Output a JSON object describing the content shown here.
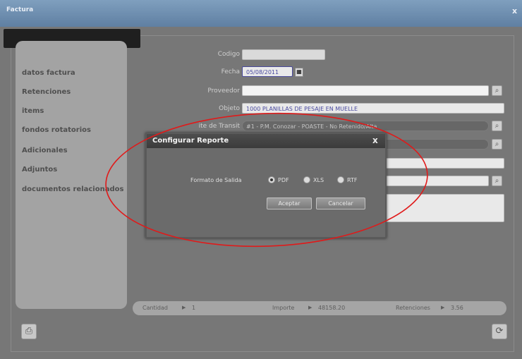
{
  "window": {
    "title": "Factura",
    "close_glyph": "x"
  },
  "sidebar": {
    "items": [
      {
        "label": "datos factura"
      },
      {
        "label": "Retenciones"
      },
      {
        "label": "items"
      },
      {
        "label": "fondos rotatorios"
      },
      {
        "label": "Adicionales"
      },
      {
        "label": "Adjuntos"
      },
      {
        "label": "documentos relacionados"
      }
    ]
  },
  "form": {
    "codigo_label": "Codigo",
    "fecha_label": "Fecha",
    "fecha_value": "05/08/2011",
    "proveedor_label": "Proveedor",
    "objeto_label": "Objeto",
    "objeto_value": "1000 PLANILLAS DE PESAJE EN MUELLE",
    "tipo_label": "ite de Transit",
    "tipo_value": "#1 - P.M. Conozar - POASTE - No Retenido/Alta"
  },
  "status": {
    "cantidad_label": "Cantidad",
    "cantidad_value": "1",
    "importe_label": "Importe",
    "importe_value": "48158.20",
    "retenciones_label": "Retenciones",
    "retenciones_value": "3.56"
  },
  "dialog": {
    "title": "Configurar Reporte",
    "close_glyph": "x",
    "format_label": "Formato de Salida",
    "options": [
      {
        "label": "PDF",
        "selected": true
      },
      {
        "label": "XLS",
        "selected": false
      },
      {
        "label": "RTF",
        "selected": false
      }
    ],
    "accept_label": "Aceptar",
    "cancel_label": "Cancelar"
  },
  "icons": {
    "print": "printer-icon",
    "refresh": "refresh-icon",
    "calendar": "calendar-icon",
    "search": "search-icon"
  },
  "colors": {
    "titlebar": "#6f8fb2",
    "annotation": "#e01a1a",
    "dialog_title": "#3f3f3f"
  }
}
